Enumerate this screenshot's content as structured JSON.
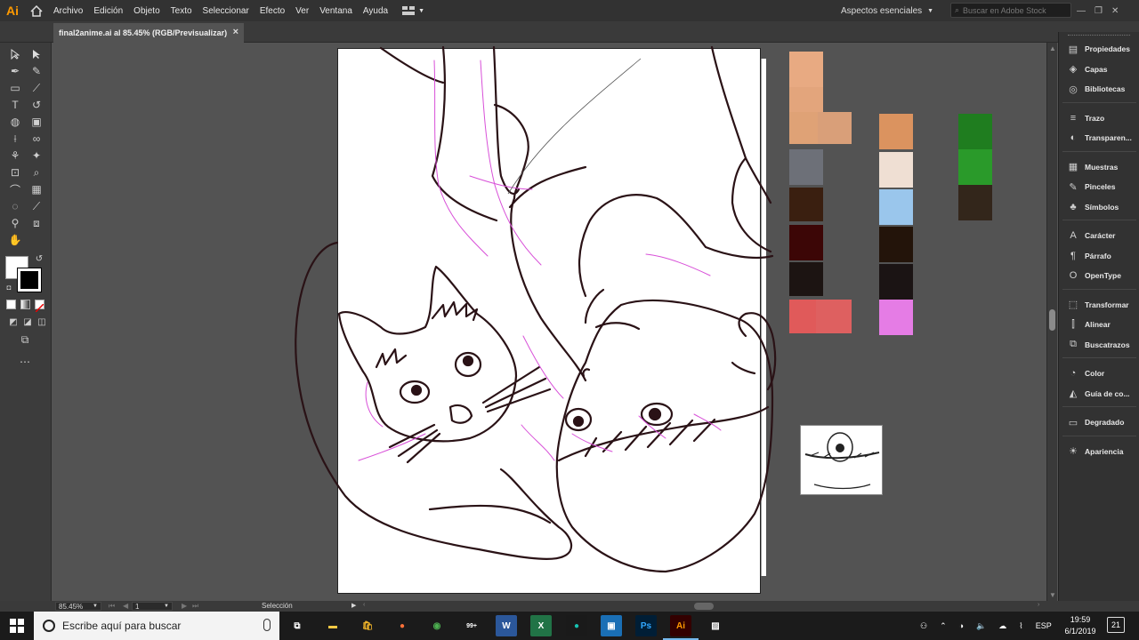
{
  "app": {
    "logo": "Ai",
    "menu": [
      "Archivo",
      "Edición",
      "Objeto",
      "Texto",
      "Seleccionar",
      "Efecto",
      "Ver",
      "Ventana",
      "Ayuda"
    ],
    "workspace": "Aspectos esenciales",
    "stock_search_placeholder": "Buscar en Adobe Stock"
  },
  "document": {
    "tab_title": "final2anime.ai al 85.45% (RGB/Previsualizar)",
    "close_glyph": "×"
  },
  "right_panel": {
    "groups": [
      [
        {
          "label": "Propiedades",
          "icon": "properties-icon",
          "glyph": "▤"
        },
        {
          "label": "Capas",
          "icon": "layers-icon",
          "glyph": "◈"
        },
        {
          "label": "Bibliotecas",
          "icon": "libraries-icon",
          "glyph": "◎"
        }
      ],
      [
        {
          "label": "Trazo",
          "icon": "stroke-icon",
          "glyph": "≡"
        },
        {
          "label": "Transparen...",
          "icon": "transparency-icon",
          "glyph": "◐"
        }
      ],
      [
        {
          "label": "Muestras",
          "icon": "swatches-icon",
          "glyph": "▦"
        },
        {
          "label": "Pinceles",
          "icon": "brushes-icon",
          "glyph": "✎"
        },
        {
          "label": "Símbolos",
          "icon": "symbols-icon",
          "glyph": "♣"
        }
      ],
      [
        {
          "label": "Carácter",
          "icon": "character-icon",
          "glyph": "A"
        },
        {
          "label": "Párrafo",
          "icon": "paragraph-icon",
          "glyph": "¶"
        },
        {
          "label": "OpenType",
          "icon": "opentype-icon",
          "glyph": "O"
        }
      ],
      [
        {
          "label": "Transformar",
          "icon": "transform-icon",
          "glyph": "⬚"
        },
        {
          "label": "Alinear",
          "icon": "align-icon",
          "glyph": "⫿"
        },
        {
          "label": "Buscatrazos",
          "icon": "pathfinder-icon",
          "glyph": "⧉"
        }
      ],
      [
        {
          "label": "Color",
          "icon": "color-icon",
          "glyph": "◔"
        },
        {
          "label": "Guía de co...",
          "icon": "color-guide-icon",
          "glyph": "◭"
        }
      ],
      [
        {
          "label": "Degradado",
          "icon": "gradient-icon",
          "glyph": "▭"
        }
      ],
      [
        {
          "label": "Apariencia",
          "icon": "appearance-icon",
          "glyph": "☀"
        }
      ]
    ]
  },
  "swatches": {
    "colors": [
      "#e8aa82",
      "#e3a57c",
      "#dfa276",
      "#d99f79",
      "#6d7078",
      "#3a1f10",
      "#3c0606",
      "#1c1412",
      "#e05a5a",
      "#de6060",
      "#db935f",
      "#efdfd3",
      "#9ac6ec",
      "#23140a",
      "#1b1414",
      "#e57ce5",
      "#1f7d1f",
      "#2a9a2a",
      "#33261b"
    ]
  },
  "status": {
    "zoom": "85.45%",
    "artboard_number": "1",
    "tool": "Selección"
  },
  "taskbar": {
    "search_placeholder": "Escribe aquí para buscar",
    "apps": [
      {
        "name": "task-view",
        "glyph": "⧉"
      },
      {
        "name": "file-explorer",
        "glyph": "▬"
      },
      {
        "name": "store",
        "glyph": "🛍"
      },
      {
        "name": "firefox",
        "glyph": "●"
      },
      {
        "name": "chrome",
        "glyph": "◉"
      },
      {
        "name": "app-badge",
        "glyph": "99+"
      },
      {
        "name": "word",
        "glyph": "W"
      },
      {
        "name": "excel",
        "glyph": "X"
      },
      {
        "name": "app-green",
        "glyph": "●"
      },
      {
        "name": "app-square",
        "glyph": "▣"
      },
      {
        "name": "photoshop",
        "glyph": "Ps"
      },
      {
        "name": "illustrator",
        "glyph": "Ai"
      },
      {
        "name": "photos",
        "glyph": "▨"
      }
    ],
    "language": "ESP",
    "time": "19:59",
    "date": "6/1/2019",
    "notifications": "21"
  }
}
